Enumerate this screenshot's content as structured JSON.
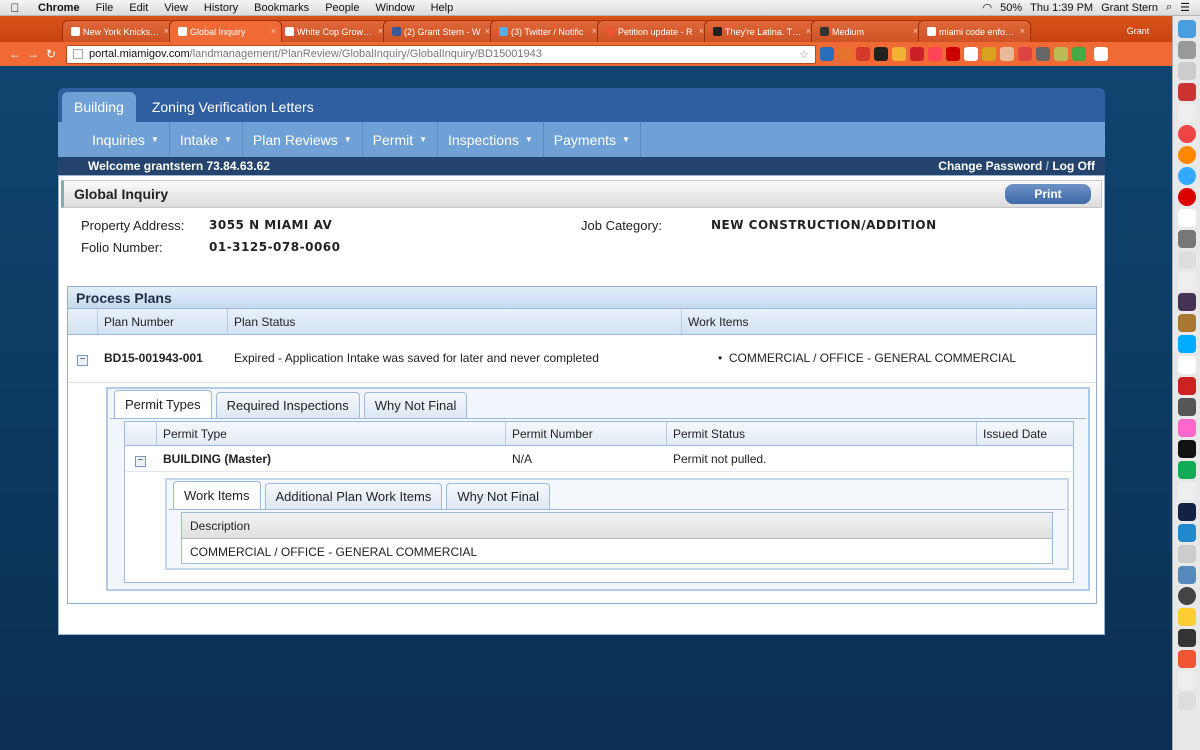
{
  "menubar": {
    "app": "Chrome",
    "items": [
      "File",
      "Edit",
      "View",
      "History",
      "Bookmarks",
      "People",
      "Window",
      "Help"
    ],
    "battery": "50%",
    "clock": "Thu 1:39 PM",
    "user": "Grant Stern"
  },
  "tabs": [
    {
      "title": "New York Knicks to"
    },
    {
      "title": "Global Inquiry",
      "active": true
    },
    {
      "title": "White Cop Growing"
    },
    {
      "title": "(2) Grant Stern - W"
    },
    {
      "title": "(3) Twitter / Notific"
    },
    {
      "title": "Petition update - R"
    },
    {
      "title": "They're Latina. Thei"
    },
    {
      "title": "Medium"
    },
    {
      "title": "miami code enforce"
    }
  ],
  "profile_tab": "Grant",
  "address": {
    "host": "portal.miamigov.com",
    "path": "/landmanagement/PlanReview/GlobalInquiry/GlobalInquiry/BD15001943"
  },
  "topnav": {
    "tabs": [
      "Building",
      "Zoning Verification Letters"
    ]
  },
  "subnav": {
    "items": [
      "Inquiries",
      "Intake",
      "Plan Reviews",
      "Permit",
      "Inspections",
      "Payments"
    ]
  },
  "welcome": {
    "text": "Welcome grantstern 73.84.63.62",
    "change_password": "Change Password",
    "separator": "/",
    "logoff": "Log Off"
  },
  "global_inquiry": {
    "title": "Global Inquiry",
    "print": "Print",
    "property_address_label": "Property Address:",
    "property_address": "3055 N MIAMI AV",
    "folio_label": "Folio Number:",
    "folio": "01-3125-078-0060",
    "job_category_label": "Job Category:",
    "job_category": "NEW CONSTRUCTION/ADDITION"
  },
  "process_plans": {
    "title": "Process Plans",
    "headers": [
      "Plan Number",
      "Plan Status",
      "Work Items"
    ],
    "row": {
      "plan_number": "BD15-001943-001",
      "plan_status": "Expired - Application Intake was saved for later and never completed",
      "work_item": "COMMERCIAL / OFFICE - GENERAL COMMERCIAL"
    },
    "tabs": [
      "Permit Types",
      "Required Inspections",
      "Why Not Final"
    ],
    "permit_headers": [
      "Permit Type",
      "Permit Number",
      "Permit Status",
      "Issued Date"
    ],
    "permit_row": {
      "type": "BUILDING (Master)",
      "number": "N/A",
      "status": "Permit not pulled.",
      "issued": ""
    },
    "work_tabs": [
      "Work Items",
      "Additional Plan Work Items",
      "Why Not Final"
    ],
    "desc_header": "Description",
    "desc_value": "COMMERCIAL / OFFICE - GENERAL COMMERCIAL"
  },
  "colors": {
    "chrome_orange": "#ef6a35",
    "nav_blue": "#2f5fa0",
    "subnav_blue": "#6fa1d6"
  }
}
